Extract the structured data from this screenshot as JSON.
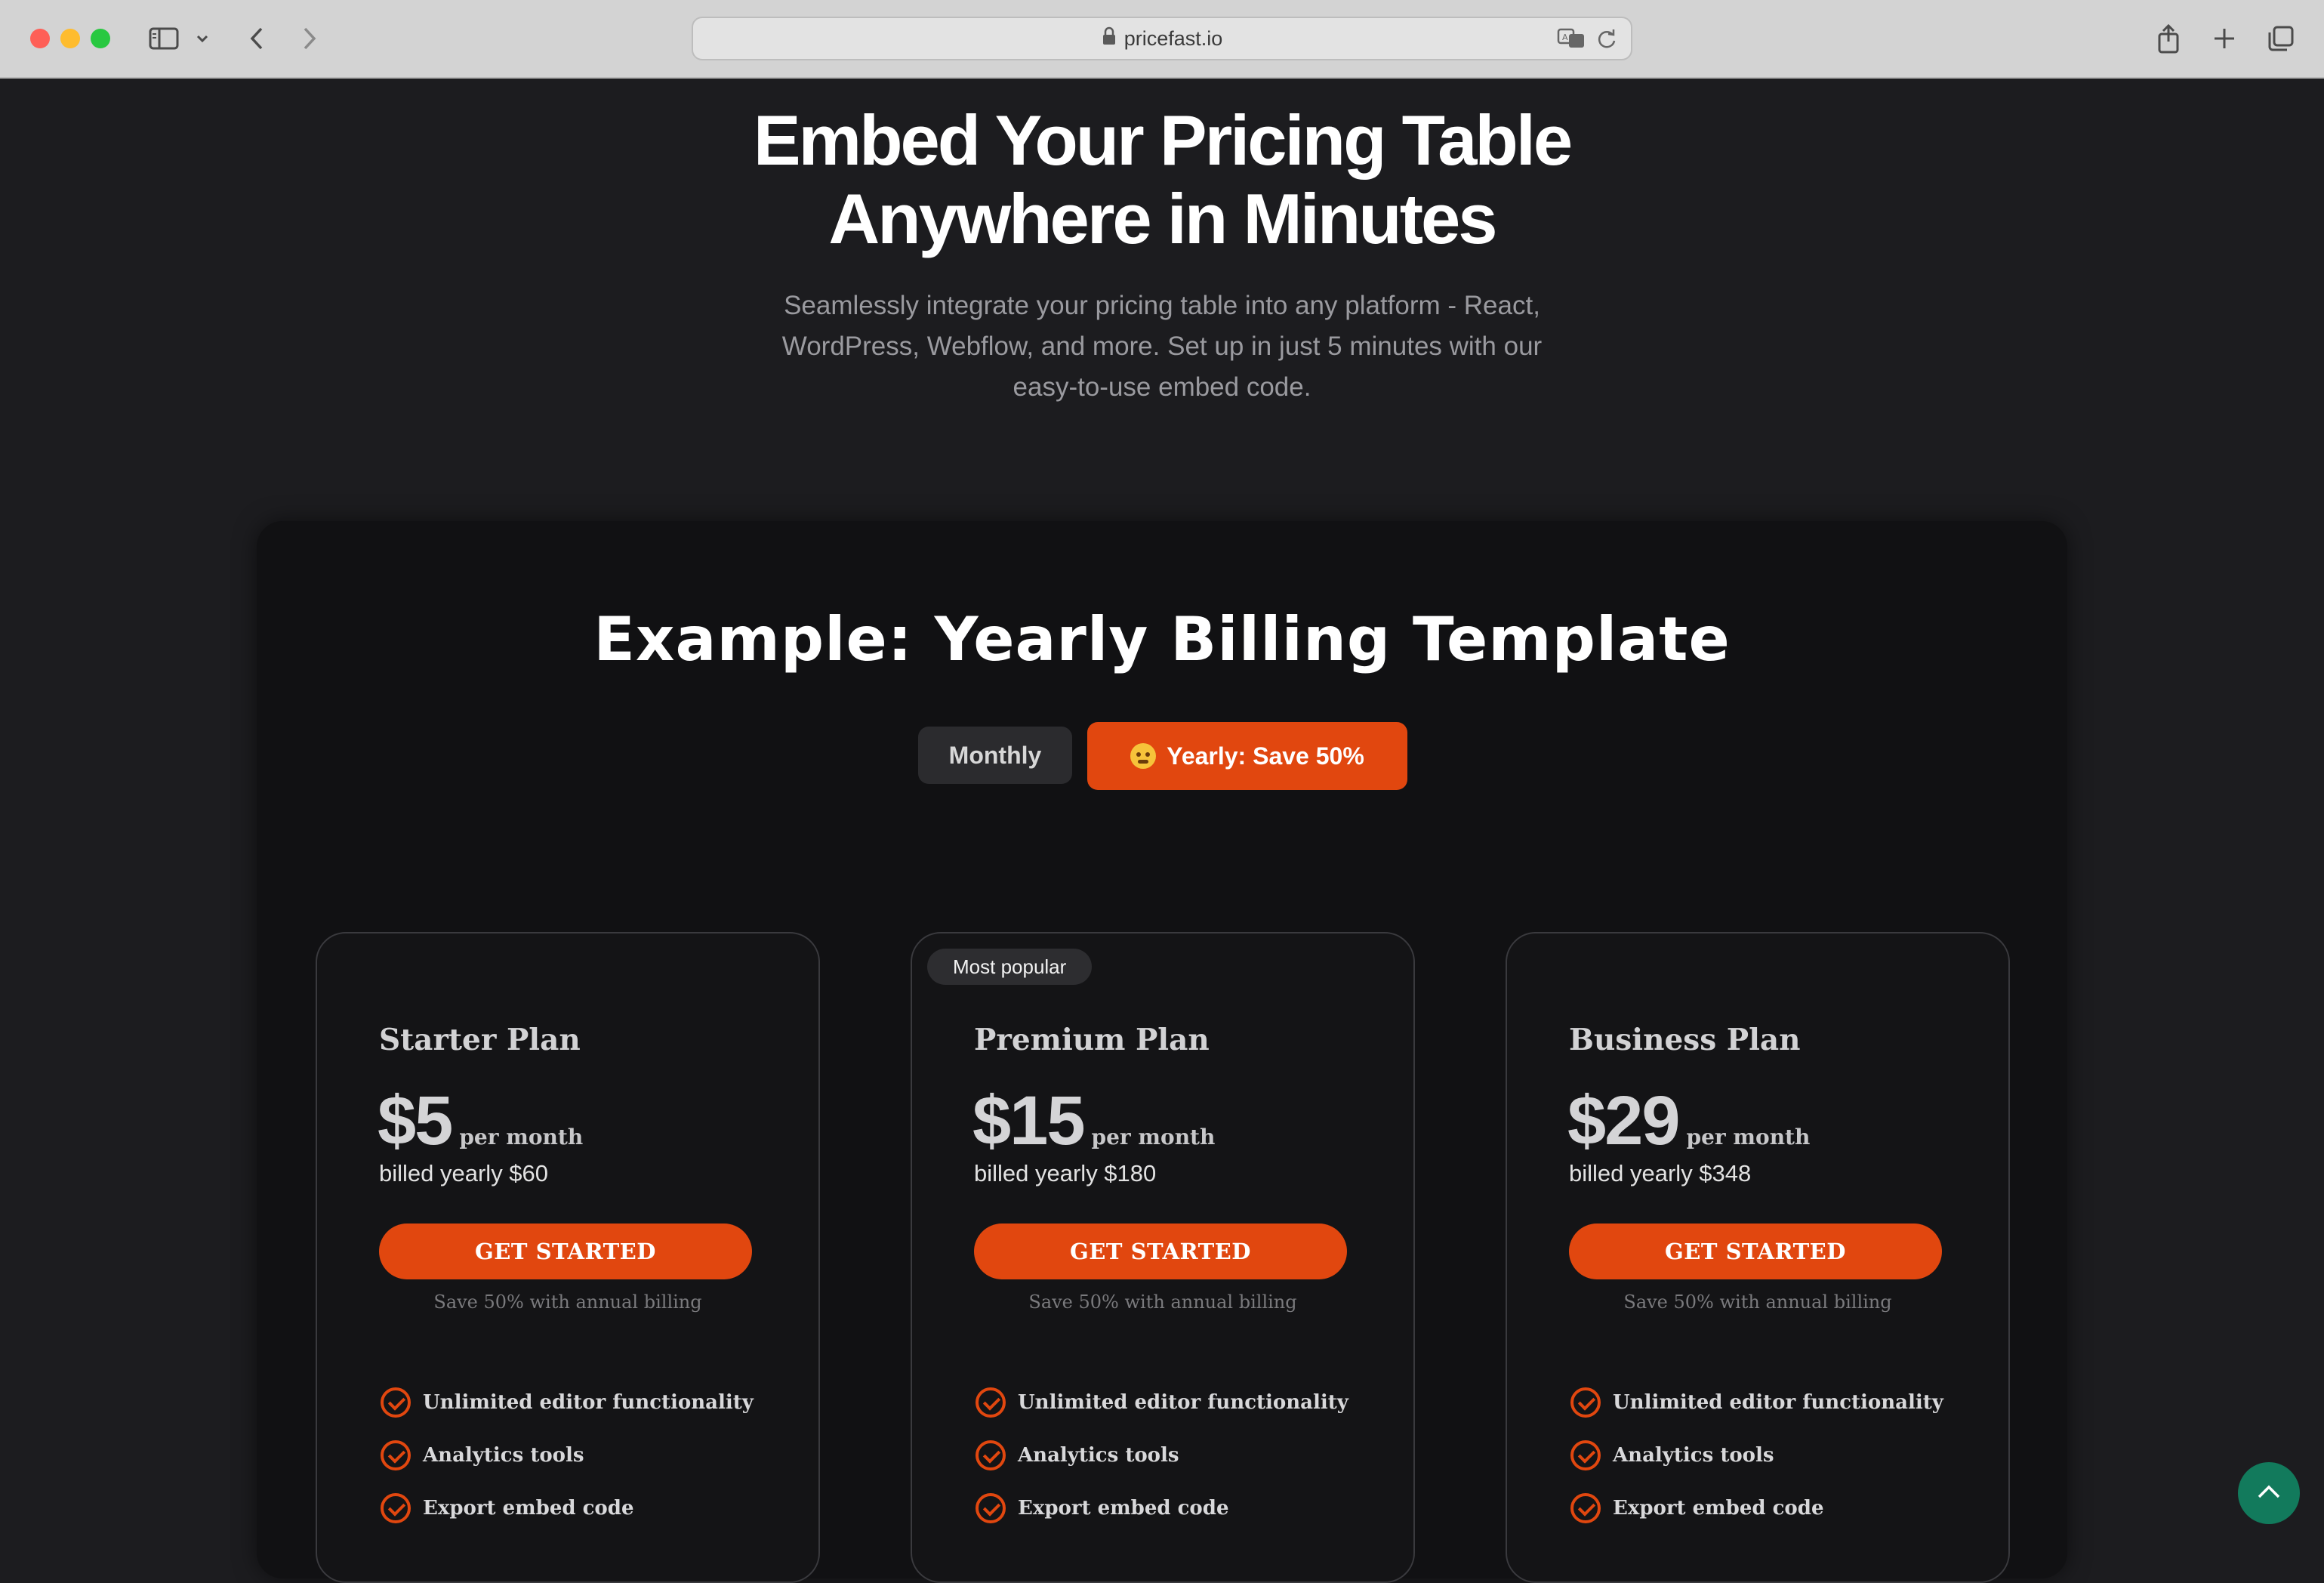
{
  "browser": {
    "url": "pricefast.io"
  },
  "hero": {
    "title_line1": "Embed Your Pricing Table",
    "title_line2": "Anywhere in Minutes",
    "subtitle_line1": "Seamlessly integrate your pricing table into any platform - React,",
    "subtitle_line2": "WordPress, Webflow, and more. Set up in just 5 minutes with our",
    "subtitle_line3": "easy-to-use embed code."
  },
  "example": {
    "title": "Example: Yearly Billing Template",
    "toggle": {
      "monthly_label": "Monthly",
      "yearly_label": "Yearly: Save 50%",
      "selected": "yearly"
    }
  },
  "plans": [
    {
      "name": "Starter Plan",
      "price": "$5",
      "period": "per month",
      "billed": "billed yearly $60",
      "cta": "GET STARTED",
      "note": "Save 50% with annual billing",
      "features": [
        "Unlimited editor functionality",
        "Analytics tools",
        "Export embed code"
      ]
    },
    {
      "badge": "Most popular",
      "name": "Premium Plan",
      "price": "$15",
      "period": "per month",
      "billed": "billed yearly $180",
      "cta": "GET STARTED",
      "note": "Save 50% with annual billing",
      "features": [
        "Unlimited editor functionality",
        "Analytics tools",
        "Export embed code"
      ]
    },
    {
      "name": "Business Plan",
      "price": "$29",
      "period": "per month",
      "billed": "billed yearly $348",
      "cta": "GET STARTED",
      "note": "Save 50% with annual billing",
      "features": [
        "Unlimited editor functionality",
        "Analytics tools",
        "Export embed code"
      ]
    }
  ],
  "colors": {
    "accent": "#e1470f",
    "background": "#1c1c1f",
    "panel": "#111113",
    "scroll_button": "#127a5c"
  },
  "icons": {
    "lock": "lock-icon",
    "translate": "translate-icon",
    "reload": "reload-icon",
    "share": "share-icon",
    "new_tab": "plus-icon",
    "tabs": "tabs-overview-icon",
    "sidebar": "sidebar-icon",
    "back": "chevron-left-icon",
    "forward": "chevron-right-icon",
    "check": "check-circle-icon",
    "scroll_top": "chevron-up-icon"
  }
}
